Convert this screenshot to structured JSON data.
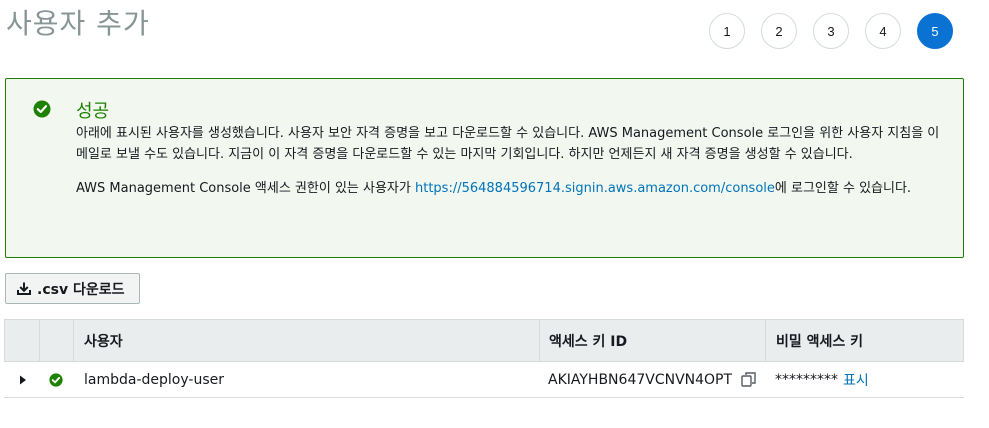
{
  "header": {
    "title": "사용자 추가"
  },
  "steps": [
    "1",
    "2",
    "3",
    "4",
    "5"
  ],
  "active_step": "5",
  "alert": {
    "title": "성공",
    "line1": "아래에 표시된 사용자를 생성했습니다. 사용자 보안 자격 증명을 보고 다운로드할 수 있습니다. AWS Management Console 로그인을 위한 사용자 지침을 이메일로 보낼 수도 있습니다. 지금이 이 자격 증명을 다운로드할 수 있는 마지막 기회입니다. 하지만 언제든지 새 자격 증명을 생성할 수 있습니다.",
    "line2_prefix": "AWS Management Console 액세스 권한이 있는 사용자가 ",
    "line2_link": "https://564884596714.signin.aws.amazon.com/console",
    "line2_suffix": "에 로그인할 수 있습니다.",
    "icon": "check-circle-icon",
    "color": "#1d8102"
  },
  "toolbar": {
    "csv_label": ".csv 다운로드",
    "csv_icon": "download-icon"
  },
  "table": {
    "columns": [
      "사용자",
      "액세스 키 ID",
      "비밀 액세스 키"
    ],
    "rows": [
      {
        "user": "lambda-deploy-user",
        "access_key_id": "AKIAYHBN647VCNVN4OPT",
        "secret_masked": "*********",
        "show_label": "표시"
      }
    ]
  },
  "colors": {
    "accent": "#0972d3",
    "link": "#0073bb",
    "success": "#1d8102"
  }
}
